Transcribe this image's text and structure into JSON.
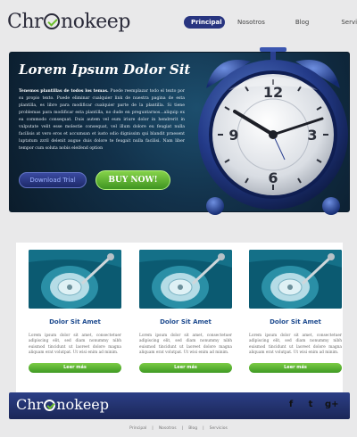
{
  "header": {
    "logo_pre": "Chr",
    "logo_post": "nokeep",
    "nav": [
      "Principal",
      "Nosotros",
      "Blog",
      "Servicios"
    ]
  },
  "hero": {
    "title": "Lorem Ipsum Dolor Sit",
    "text_lead": "Tenemos plantillas de todos los temas.",
    "text_body": " Puede reemplazar todo el texto por su propio texto. Puede eliminar cualquier link de nuestra pagina de esta plantilla, es libre para modificar cualquier parte de la plantilla. Si tiene problemas para modificar esta plantilla, no dude en preguntarnos...aliquip ex ea commodo consequat. Duis autem vel eum iriure dolor in hendrerit in vulputate velit esse molestie consequat, vel illum dolore eu feugiat nulla facilisis at vero eros et accumsan et iusto odio dignissim qui blandit praesent luptatum zzril delenit augue duis dolore te feugait nulla facilisi. Nam liber tempor cum soluta nobis eleifend option",
    "demo_label": "Download Trial",
    "buy_label": "BUY NOW!",
    "clock_numbers": [
      "12",
      "3",
      "6",
      "9"
    ]
  },
  "cards": [
    {
      "title": "Dolor Sit Amet",
      "text": "Lorem ipsum dolor sit amet, consectetuer adipiscing elit, sed diam nonummy nibh euismod tincidunt ut laoreet dolore magna aliquam erat volutpat. Ut wisi enim ad minim.",
      "button": "Leer más"
    },
    {
      "title": "Dolor Sit Amet",
      "text": "Lorem ipsum dolor sit amet, consectetuer adipiscing elit, sed diam nonummy nibh euismod tincidunt ut laoreet dolore magna aliquam erat volutpat. Ut wisi enim ad minim.",
      "button": "Leer más"
    },
    {
      "title": "Dolor Sit Amet",
      "text": "Lorem ipsum dolor sit amet, consectetuer adipiscing elit, sed diam nonummy nibh euismod tincidunt ut laoreet dolore magna aliquam erat volutpat. Ut wisi enim ad minim.",
      "button": "Leer más"
    }
  ],
  "footer": {
    "logo_pre": "Chr",
    "logo_post": "nokeep",
    "social": [
      "facebook-icon",
      "twitter-icon",
      "google-plus-icon"
    ],
    "social_glyphs": [
      "f",
      "t",
      "g+"
    ],
    "links": [
      "Principal",
      "Nosotros",
      "Blog",
      "Servicios"
    ],
    "separator": "|"
  },
  "colors": {
    "nav_active": "#283580",
    "buy_green": "#5cb533",
    "footer_blue": "#2c3f86",
    "card_title": "#1e4b8f"
  }
}
